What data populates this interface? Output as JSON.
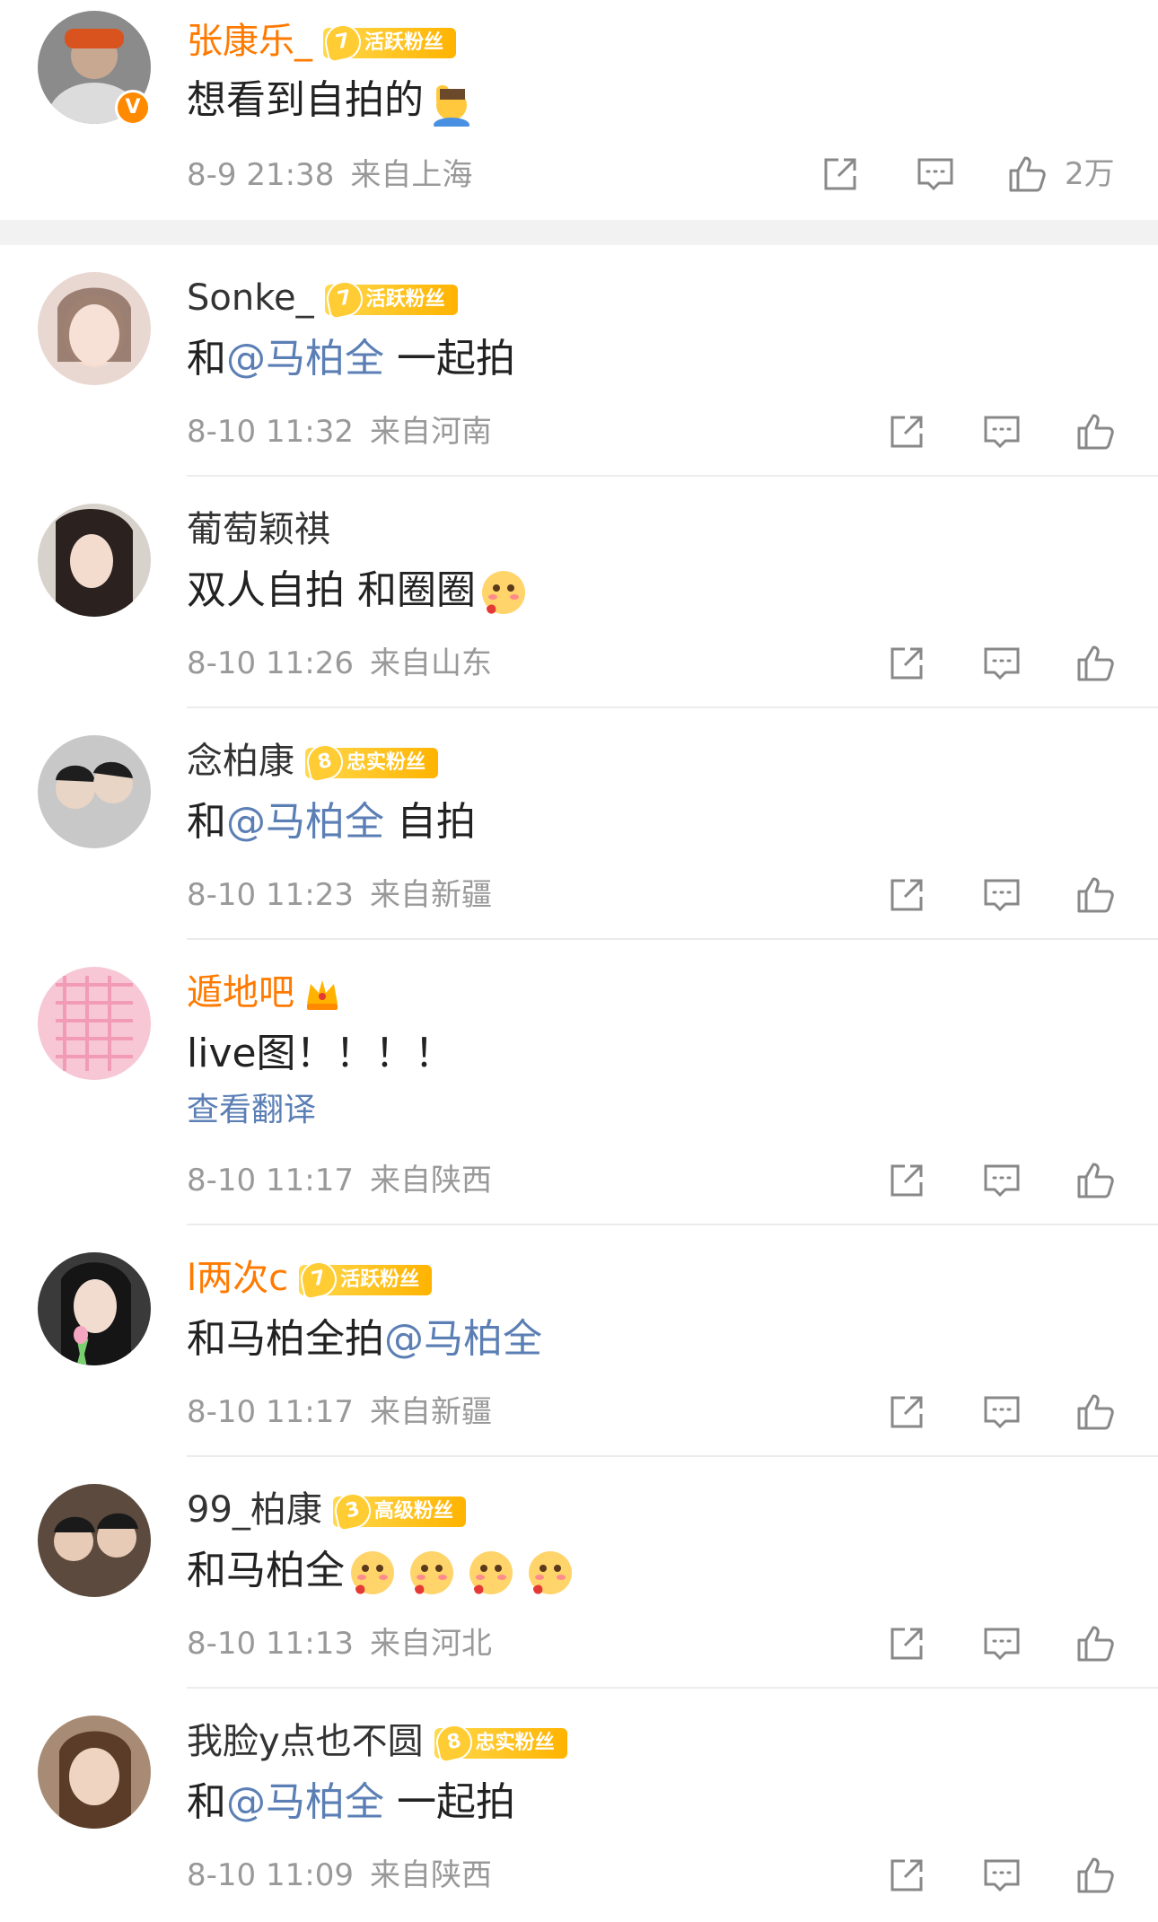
{
  "top_comment": {
    "name": "张康乐_",
    "fan_badge": {
      "level": "7",
      "label": "活跃粉丝"
    },
    "text": "想看到自拍的",
    "time": "8-9 21:38",
    "location": "来自上海",
    "likes": "2万"
  },
  "comments": [
    {
      "name": "Sonke_",
      "fan_badge": {
        "level": "7",
        "label": "活跃粉丝"
      },
      "text_before": "和",
      "mention": "@马柏全",
      "text_after": " 一起拍",
      "time": "8-10 11:32",
      "location": "来自河南"
    },
    {
      "name": "葡萄颖祺",
      "text_before": "双人自拍 和圈圈",
      "time": "8-10 11:26",
      "location": "来自山东"
    },
    {
      "name": "念柏康",
      "fan_badge": {
        "level": "8",
        "label": "忠实粉丝"
      },
      "text_before": "和",
      "mention": "@马柏全",
      "text_after": " 自拍",
      "time": "8-10 11:23",
      "location": "来自新疆"
    },
    {
      "name": "遁地吧",
      "text_before": "live图！！！！",
      "translate": "查看翻译",
      "time": "8-10 11:17",
      "location": "来自陕西"
    },
    {
      "name": "l两次c",
      "fan_badge": {
        "level": "7",
        "label": "活跃粉丝"
      },
      "text_before": "和马柏全拍",
      "mention": "@马柏全",
      "time": "8-10 11:17",
      "location": "来自新疆"
    },
    {
      "name": "99_柏康",
      "fan_badge": {
        "level": "3",
        "label": "高级粉丝"
      },
      "text_before": "和马柏全",
      "time": "8-10 11:13",
      "location": "来自河北"
    },
    {
      "name": "我脸y点也不圆",
      "fan_badge": {
        "level": "8",
        "label": "忠实粉丝"
      },
      "text_before": "和",
      "mention": "@马柏全",
      "text_after": " 一起拍",
      "time": "8-10 11:09",
      "location": "来自陕西"
    }
  ],
  "icons": {
    "share": "share-icon",
    "comment": "comment-icon",
    "like": "like-icon",
    "verified": "verified-icon",
    "crown": "crown-icon",
    "emoji": "blush-emoji"
  },
  "colors": {
    "accent_orange": "#ff7a00",
    "mention_blue": "#5b7fb5",
    "meta_gray": "#999999",
    "divider": "#ececec"
  }
}
